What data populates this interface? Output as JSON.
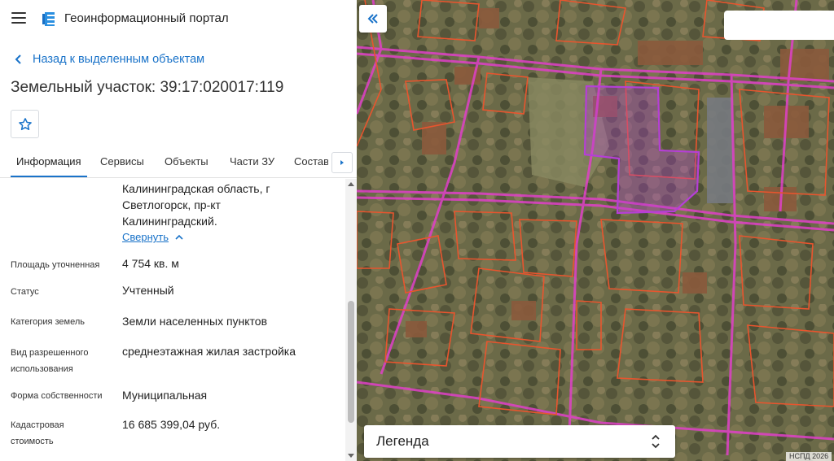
{
  "header": {
    "title": "Геоинформационный портал",
    "menu_icon": "hamburger-menu-icon",
    "logo_icon": "portal-logo-icon"
  },
  "back_link": {
    "label": "Назад к выделенным объектам",
    "icon": "chevron-left-icon"
  },
  "parcel": {
    "title": "Земельный участок: 39:17:020017:119"
  },
  "favorite": {
    "icon": "star-outline-icon"
  },
  "tabs": [
    {
      "label": "Информация",
      "active": true
    },
    {
      "label": "Сервисы",
      "active": false
    },
    {
      "label": "Объекты",
      "active": false
    },
    {
      "label": "Части ЗУ",
      "active": false
    },
    {
      "label": "Состав",
      "active": false
    }
  ],
  "tabs_more_icon": "triangle-right-icon",
  "info": {
    "address_lines": [
      "Калининградская область, г",
      "Светлогорск, пр-кт",
      "Калининградский."
    ],
    "collapse_label": "Свернуть",
    "rows": [
      {
        "label": "Площадь уточненная",
        "value": "4 754 кв. м"
      },
      {
        "label": "Статус",
        "value": "Учтенный"
      },
      {
        "label": "Категория земель",
        "value": "Земли населенных пунктов"
      },
      {
        "label_lines": [
          "Вид разрешенного",
          "использования"
        ],
        "value": "среднеэтажная жилая застройка"
      },
      {
        "label": "Форма собственности",
        "value": "Муниципальная"
      },
      {
        "label_lines": [
          "Кадастровая",
          "стоимость"
        ],
        "value": "16 685 399,04 руб."
      }
    ]
  },
  "map": {
    "collapse_icon": "double-chevron-left-icon",
    "search_placeholder": "",
    "legend_label": "Легенда",
    "legend_icon": "up-down-chevron-icon",
    "copyright": "НСПД 2026"
  },
  "colors": {
    "accent": "#1a73c9",
    "parcel_boundary": "#e8552e",
    "selected_parcel": "#b53fd6",
    "road_line": "#e040c8"
  }
}
